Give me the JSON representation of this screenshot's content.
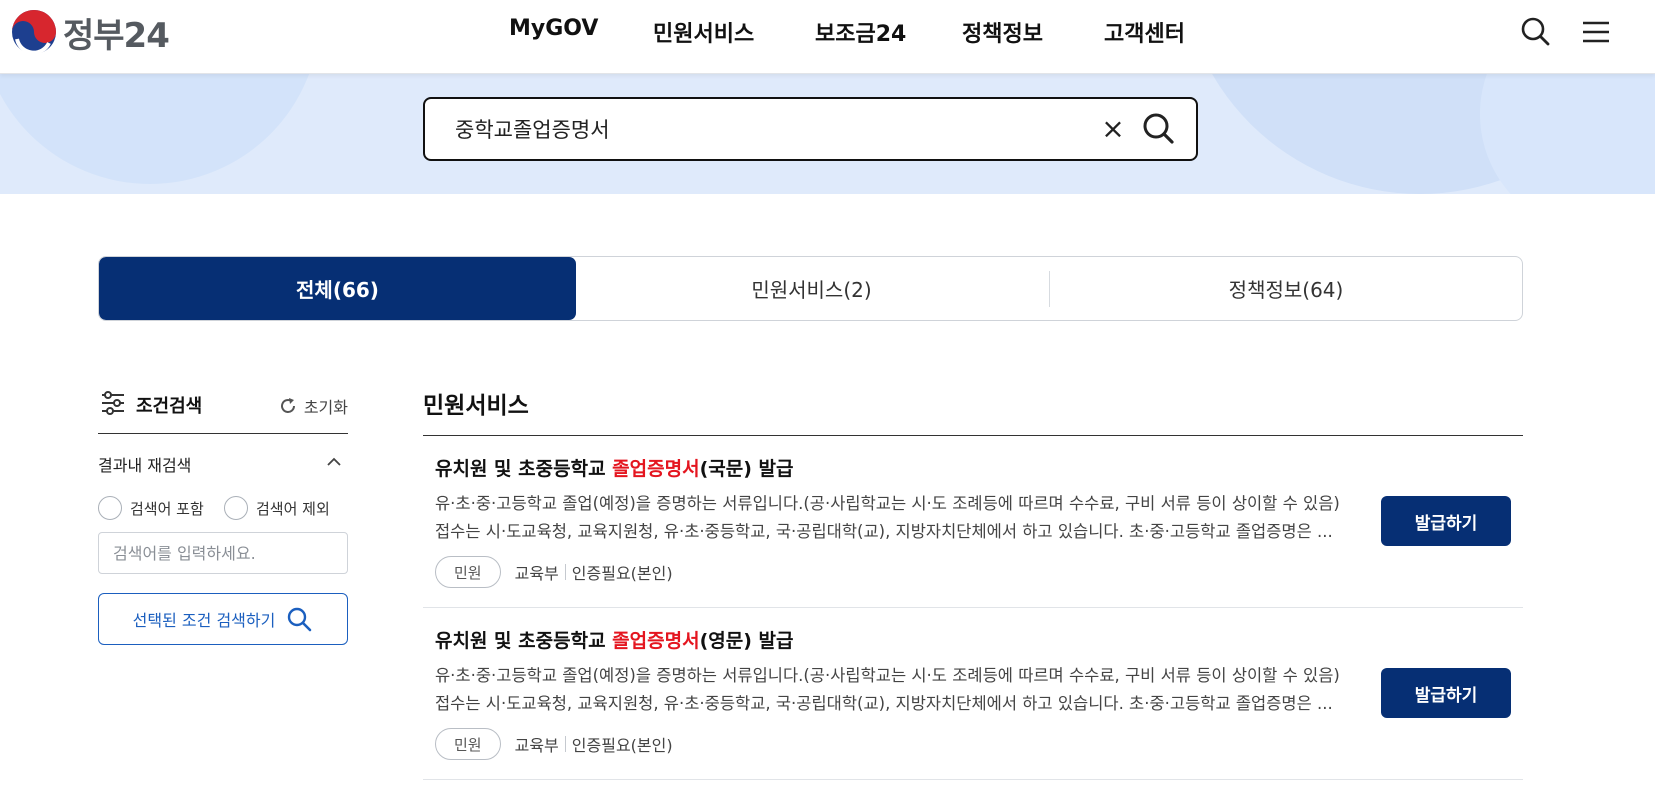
{
  "header": {
    "logo_text": "정부24",
    "nav": [
      "MyGOV",
      "민원서비스",
      "보조금24",
      "정책정보",
      "고객센터"
    ]
  },
  "search": {
    "value": "중학교졸업증명서",
    "clear_label": "×"
  },
  "tabs": [
    {
      "label": "전체(66)",
      "active": true
    },
    {
      "label": "민원서비스(2)",
      "active": false
    },
    {
      "label": "정책정보(64)",
      "active": false
    }
  ],
  "sidebar": {
    "title": "조건검색",
    "reset_label": "초기화",
    "subsection_title": "결과내 재검색",
    "radio_include": "검색어 포함",
    "radio_exclude": "검색어 제외",
    "input_placeholder": "검색어를 입력하세요.",
    "search_button": "선택된 조건 검색하기"
  },
  "results": {
    "section_title": "민원서비스",
    "items": [
      {
        "title_prefix": "유치원 및 초중등학교 ",
        "title_highlight": "졸업증명서",
        "title_suffix": "(국문) 발급",
        "desc_line1": "유·초·중·고등학교 졸업(예정)을 증명하는 서류입니다.(공·사립학교는 시·도 조례등에 따르며 수수료, 구비 서류 등이 상이할 수 있음)",
        "desc_line2": "접수는 시·도교육청, 교육지원청, 유·초·중등학교, 국·공립대학(교), 지방자치단체에서 하고 있습니다. 초·중·고등학교 졸업증명은 ...",
        "tag": "민원",
        "org": "교육부",
        "auth": "인증필요(본인)",
        "button": "발급하기"
      },
      {
        "title_prefix": "유치원 및 초중등학교 ",
        "title_highlight": "졸업증명서",
        "title_suffix": "(영문) 발급",
        "desc_line1": "유·초·중·고등학교 졸업(예정)을 증명하는 서류입니다.(공·사립학교는 시·도 조례등에 따르며 수수료, 구비 서류 등이 상이할 수 있음)",
        "desc_line2": "접수는 시·도교육청, 교육지원청, 유·초·중등학교, 국·공립대학(교), 지방자치단체에서 하고 있습니다. 초·중·고등학교 졸업증명은 ...",
        "tag": "민원",
        "org": "교육부",
        "auth": "인증필요(본인)",
        "button": "발급하기"
      }
    ]
  },
  "colors": {
    "primary": "#062f74",
    "highlight": "#e4151f",
    "banner": "#dfeafb",
    "link_blue": "#1b5fbf"
  }
}
